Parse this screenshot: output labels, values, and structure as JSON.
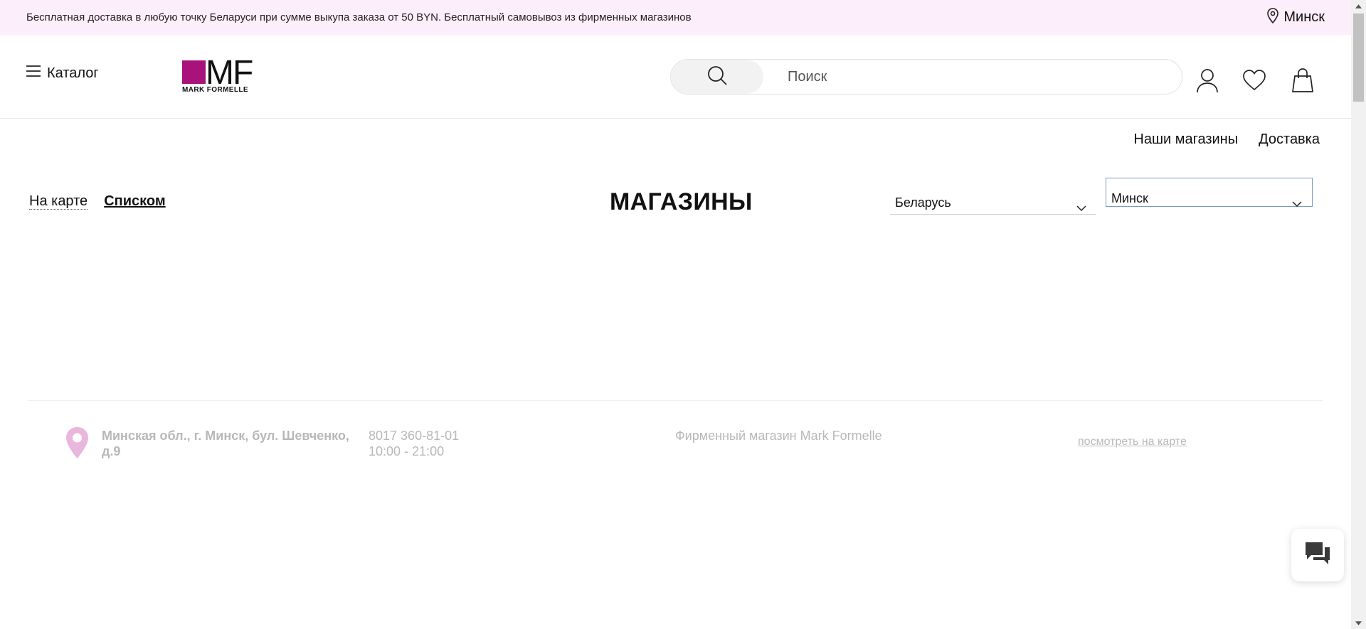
{
  "promo": {
    "text": "Бесплатная доставка в любую точку Беларуси при сумме выкупа заказа от 50 BYN. Бесплатный самовывоз из фирменных магазинов",
    "city": "Минск"
  },
  "header": {
    "catalog_label": "Каталог",
    "logo_text": "MARK FORMELLE",
    "logo_letters": "MF",
    "search_placeholder": "Поиск",
    "brand_color": "#a8127a"
  },
  "subnav": {
    "items": [
      "Наши магазины",
      "Доставка"
    ]
  },
  "stores_page": {
    "view_map": "На карте",
    "view_list": "Списком",
    "title": "МАГАЗИНЫ",
    "country_selected": "Беларусь",
    "city_selected": "Минск"
  },
  "stores": [
    {
      "address": "Минская обл., г. Минск, бул. Шевченко, д.9",
      "phone": "8017 360-81-01",
      "hours": "10:00 - 21:00",
      "type": "Фирменный магазин Mark Formelle",
      "map_link": "посмотреть на карте"
    }
  ],
  "icons": {
    "location": "location-pin-icon",
    "menu": "hamburger-menu-icon",
    "search": "search-icon",
    "account": "user-icon",
    "favorites": "heart-icon",
    "cart": "shopping-bag-icon",
    "chat": "chat-icon"
  }
}
